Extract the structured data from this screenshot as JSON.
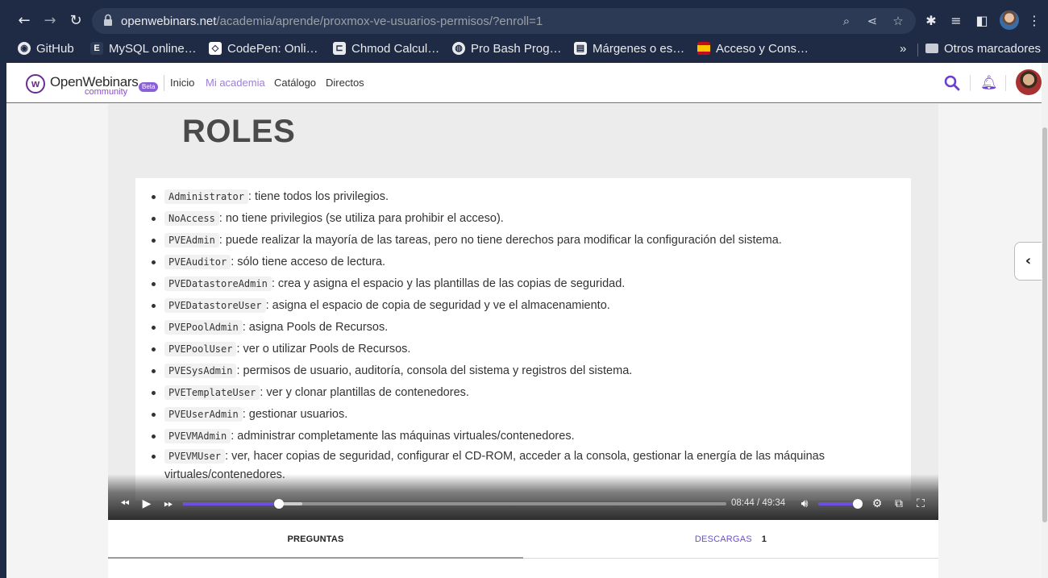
{
  "browser": {
    "url_host": "openwebinars.net",
    "url_path": "/academia/aprende/proxmox-ve-usuarios-permisos/?enroll=1",
    "bookmarks": [
      {
        "label": "GitHub",
        "icon": "github-icon"
      },
      {
        "label": "MySQL online…",
        "icon": "e-icon"
      },
      {
        "label": "CodePen: Onli…",
        "icon": "codepen-icon"
      },
      {
        "label": "Chmod Calcul…",
        "icon": "chmod-icon"
      },
      {
        "label": "Pro Bash Prog…",
        "icon": "globe-icon"
      },
      {
        "label": "Márgenes o es…",
        "icon": "page-icon"
      },
      {
        "label": "Acceso y Cons…",
        "icon": "spain-flag-icon"
      }
    ],
    "more_bookmarks": "»",
    "other_bookmarks": "Otros marcadores"
  },
  "site": {
    "logo_text": "OpenWebinars",
    "logo_sub": "community",
    "beta": "Beta",
    "nav": [
      "Inicio",
      "Mi academia",
      "Catálogo",
      "Directos"
    ],
    "active_nav": "Mi academia"
  },
  "slide": {
    "title": "ROLES",
    "roles": [
      {
        "code": "Administrator",
        "desc": ": tiene todos los privilegios."
      },
      {
        "code": "NoAccess",
        "desc": ": no tiene privilegios (se utiliza para prohibir el acceso)."
      },
      {
        "code": "PVEAdmin",
        "desc": ": puede realizar la mayoría de las tareas, pero no tiene derechos para modificar la configuración del sistema."
      },
      {
        "code": "PVEAuditor",
        "desc": ": sólo tiene acceso de lectura."
      },
      {
        "code": "PVEDatastoreAdmin",
        "desc": ": crea y asigna el espacio y las plantillas de las copias de seguridad."
      },
      {
        "code": "PVEDatastoreUser",
        "desc": ": asigna el espacio de copia de seguridad y ve el almacenamiento."
      },
      {
        "code": "PVEPoolAdmin",
        "desc": ": asigna Pools de Recursos."
      },
      {
        "code": "PVEPoolUser",
        "desc": ": ver o utilizar Pools de Recursos."
      },
      {
        "code": "PVESysAdmin",
        "desc": ": permisos de usuario, auditoría, consola del sistema y registros del sistema."
      },
      {
        "code": "PVETemplateUser",
        "desc": ": ver y clonar plantillas de contenedores."
      },
      {
        "code": "PVEUserAdmin",
        "desc": ": gestionar usuarios."
      },
      {
        "code": "PVEVMAdmin",
        "desc": ": administrar completamente las máquinas virtuales/contenedores."
      },
      {
        "code": "PVEVMUser",
        "desc": ": ver, hacer copias de seguridad, configurar el CD-ROM, acceder a la consola, gestionar la energía de las máquinas virtuales/contenedores."
      }
    ]
  },
  "player": {
    "current_time": "08:44",
    "duration": "49:34",
    "time_separator": "/",
    "played_fraction": 0.1762,
    "buffered_fraction": 0.22,
    "volume_fraction": 0.9,
    "accent_color": "#6c4fe0"
  },
  "tabs": {
    "questions": "PREGUNTAS",
    "downloads": "DESCARGAS",
    "downloads_count": "1"
  }
}
